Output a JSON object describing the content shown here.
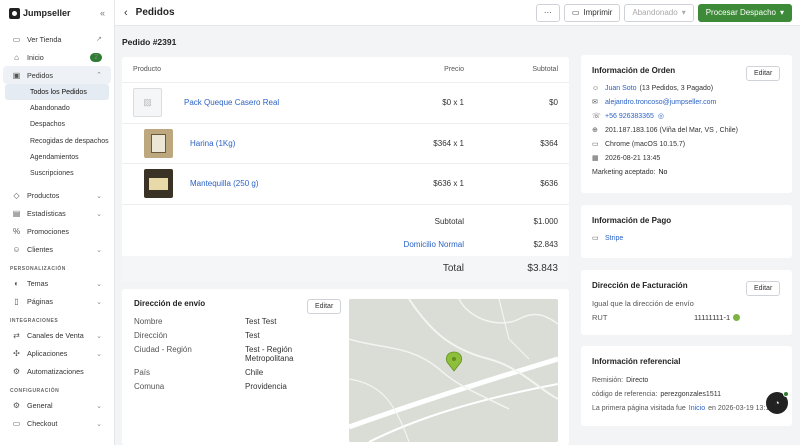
{
  "brand": "Jumpseller",
  "sidebar": {
    "top": [
      {
        "label": "Ver Tienda",
        "icon": "external-link-icon"
      },
      {
        "label": "Inicio",
        "badge": "2"
      },
      {
        "label": "Pedidos"
      }
    ],
    "pedidos_sub": [
      "Todos los Pedidos",
      "Abandonado",
      "Despachos",
      "Recogidas de despachos",
      "Agendamientos",
      "Suscripciones"
    ],
    "main": [
      "Productos",
      "Estadísticas",
      "Promociones",
      "Clientes"
    ],
    "personalizacion_title": "PERSONALIZACIÓN",
    "personalizacion": [
      "Temas",
      "Páginas"
    ],
    "integraciones_title": "INTEGRACIONES",
    "integraciones": [
      "Canales de Venta",
      "Aplicaciones",
      "Automatizaciones"
    ],
    "configuracion_title": "CONFIGURACIÓN",
    "configuracion": [
      "General",
      "Checkout"
    ]
  },
  "topbar": {
    "title": "Pedidos",
    "more": "···",
    "print": "Imprimir",
    "abandon": "Abandonado",
    "process": "Procesar Despacho"
  },
  "order_title": "Pedido #2391",
  "products": {
    "headers": {
      "product": "Producto",
      "price": "Precio",
      "subtotal": "Subtotal"
    },
    "items": [
      {
        "name": "Pack Queque Casero Real",
        "price": "$0 x 1",
        "subtotal": "$0"
      },
      {
        "name": "Harina (1Kg)",
        "price": "$364 x 1",
        "subtotal": "$364"
      },
      {
        "name": "Mantequilla (250 g)",
        "price": "$636 x 1",
        "subtotal": "$636"
      }
    ],
    "subtotal_label": "Subtotal",
    "subtotal_value": "$1.000",
    "shipping_label": "Domicilio Normal",
    "shipping_value": "$2.843",
    "total_label": "Total",
    "total_value": "$3.843"
  },
  "shipping": {
    "title": "Dirección de envío",
    "edit": "Editar",
    "rows": [
      {
        "label": "Nombre",
        "value": "Test Test"
      },
      {
        "label": "Dirección",
        "value": "Test"
      },
      {
        "label": "Ciudad - Región",
        "value": "Test - Región Metropolitana"
      },
      {
        "label": "País",
        "value": "Chile"
      },
      {
        "label": "Comuna",
        "value": "Providencia"
      }
    ]
  },
  "order_info": {
    "title": "Información de Orden",
    "edit": "Editar",
    "customer_name": "Juan Soto",
    "customer_meta": "(13 Pedidos, 3 Pagado)",
    "email": "alejandro.troncoso@jumpseller.com",
    "phone": "+56 926383365",
    "ip": "201.187.183.106 (Viña del Mar, VS , Chile)",
    "browser": "Chrome (macOS 10.15.7)",
    "date": "2026-08-21 13:45",
    "marketing_label": "Marketing aceptado:",
    "marketing_value": "No"
  },
  "payment": {
    "title": "Información de Pago",
    "method": "Stripe"
  },
  "billing": {
    "title": "Dirección de Facturación",
    "edit": "Editar",
    "same": "Igual que la dirección de envío",
    "rut_label": "RUT",
    "rut_value": "11111111-1"
  },
  "referral": {
    "title": "Información referencial",
    "remision_label": "Remisión:",
    "remision_value": "Directo",
    "code_label": "código de referencia:",
    "code_value": "perezgonzales1511",
    "first_page_prefix": "La primera página visitada fue",
    "first_page_link": "Inicio",
    "first_page_suffix": "en 2026-03-19 13:12"
  },
  "colors": {
    "accent": "#3d8a38",
    "link": "#2b63c6"
  }
}
